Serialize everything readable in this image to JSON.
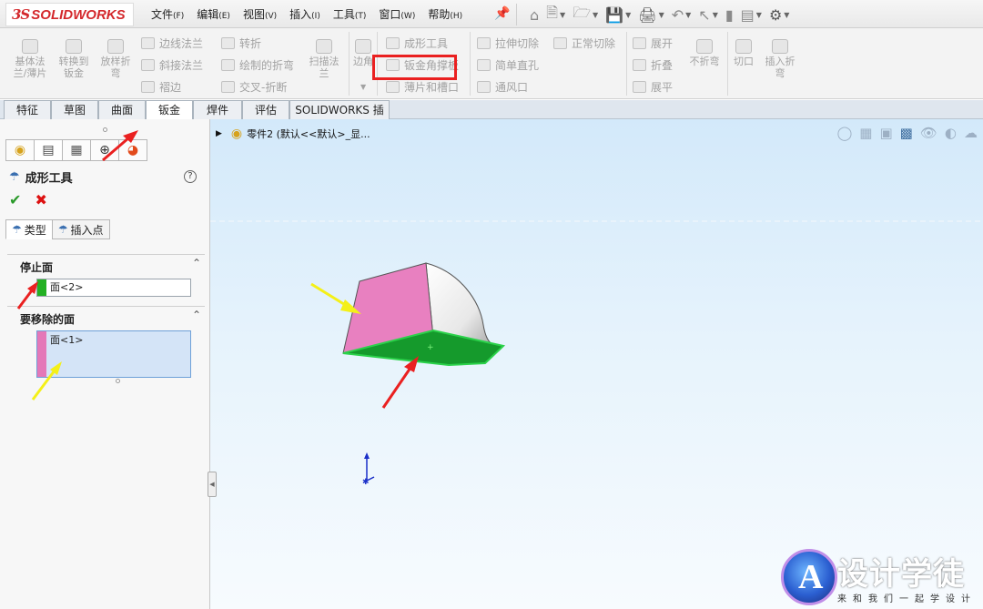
{
  "app": {
    "logo_ds": "3S",
    "logo_name": "SOLIDWORKS"
  },
  "menu": [
    {
      "label": "文件",
      "key": "(F)"
    },
    {
      "label": "编辑",
      "key": "(E)"
    },
    {
      "label": "视图",
      "key": "(V)"
    },
    {
      "label": "插入",
      "key": "(I)"
    },
    {
      "label": "工具",
      "key": "(T)"
    },
    {
      "label": "窗口",
      "key": "(W)"
    },
    {
      "label": "帮助",
      "key": "(H)"
    }
  ],
  "ribbon": {
    "base_flange_l1": "基体法",
    "base_flange_l2": "兰/薄片",
    "convert_l1": "转换到",
    "convert_l2": "钣金",
    "lofted_l1": "放样折",
    "lofted_l2": "弯",
    "edge_flange": "边线法兰",
    "miter_flange": "斜接法兰",
    "hem": "褶边",
    "jog": "转折",
    "sketched_bend": "绘制的折弯",
    "cross_break": "交叉-折断",
    "swept_l1": "扫描法",
    "swept_l2": "兰",
    "corner": "边角",
    "forming_tool": "成形工具",
    "gusset": "钣金角撑板",
    "tab_slot": "薄片和槽口",
    "extruded_cut": "拉伸切除",
    "normal_cut": "正常切除",
    "simple_hole": "简单直孔",
    "vent": "通风口",
    "unfold": "展开",
    "fold": "折叠",
    "flatten": "展平",
    "no_bends": "不折弯",
    "rip": "切口",
    "insert_bends_l1": "插入折",
    "insert_bends_l2": "弯"
  },
  "tabs": [
    "特征",
    "草图",
    "曲面",
    "钣金",
    "焊件",
    "评估",
    "SOLIDWORKS 插件"
  ],
  "panel": {
    "title": "成形工具",
    "subtab_type": "类型",
    "subtab_insert": "插入点",
    "stop_face_header": "停止面",
    "stop_face_value": "面<2>",
    "remove_faces_header": "要移除的面",
    "remove_faces_value": "面<1>"
  },
  "tree": {
    "part_label": "零件2  (默认<<默认>_显..."
  },
  "watermark": {
    "title": "设计学徒",
    "subtitle": "来和我们一起学设计",
    "logo_letter": "A"
  },
  "colors": {
    "stop_face": "#23b023",
    "remove_face": "#e478b8",
    "annotation_red": "#ea2020",
    "annotation_yellow": "#f4f018"
  }
}
